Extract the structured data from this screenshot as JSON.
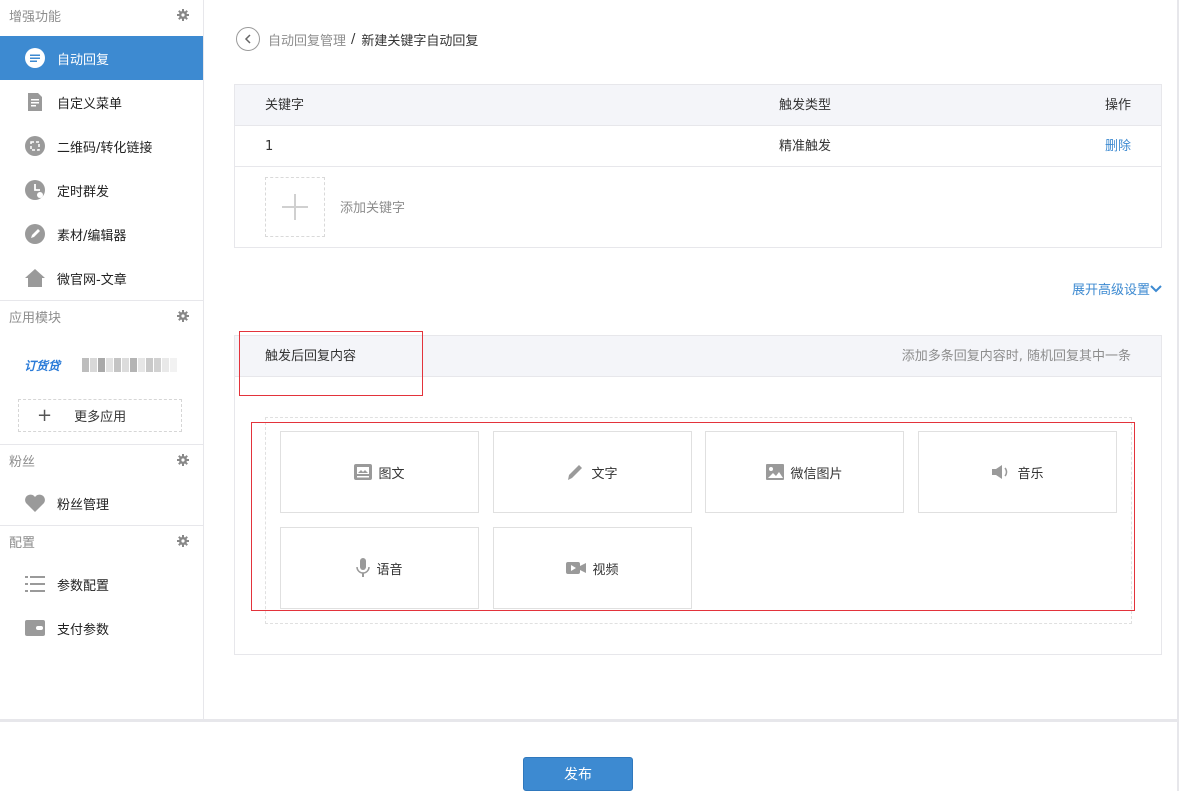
{
  "sidebar": {
    "sections": {
      "enhance": {
        "title": "增强功能"
      },
      "apps": {
        "title": "应用模块"
      },
      "fans": {
        "title": "粉丝"
      },
      "config": {
        "title": "配置"
      }
    },
    "items": {
      "auto_reply": {
        "label": "自动回复",
        "icon": "chat-bubble-icon"
      },
      "custom_menu": {
        "label": "自定义菜单",
        "icon": "document-edit-icon"
      },
      "qrcode": {
        "label": "二维码/转化链接",
        "icon": "qrcode-icon"
      },
      "scheduled": {
        "label": "定时群发",
        "icon": "clock-icon"
      },
      "material": {
        "label": "素材/编辑器",
        "icon": "pencil-icon"
      },
      "microsite": {
        "label": "微官网-文章",
        "icon": "home-icon"
      },
      "fan_manage": {
        "label": "粉丝管理",
        "icon": "heart-icon"
      },
      "params": {
        "label": "参数配置",
        "icon": "list-icon"
      },
      "pay_params": {
        "label": "支付参数",
        "icon": "wallet-icon"
      }
    },
    "app_module": {
      "logo_text": "订货贷"
    },
    "more_apps": {
      "label": "更多应用"
    }
  },
  "breadcrumb": {
    "parent": "自动回复管理",
    "separator": "/",
    "current": "新建关键字自动回复"
  },
  "keyword_table": {
    "headers": {
      "keyword": "关键字",
      "trigger_type": "触发类型",
      "action": "操作"
    },
    "rows": [
      {
        "keyword": "1",
        "trigger_type": "精准触发",
        "action": "删除"
      }
    ],
    "add_label": "添加关键字"
  },
  "advanced": {
    "label": "展开高级设置"
  },
  "reply": {
    "title": "触发后回复内容",
    "hint": "添加多条回复内容时, 随机回复其中一条",
    "types": {
      "news": {
        "label": "图文",
        "icon": "image-text-icon"
      },
      "text": {
        "label": "文字",
        "icon": "pencil-icon"
      },
      "wechat_image": {
        "label": "微信图片",
        "icon": "picture-icon"
      },
      "music": {
        "label": "音乐",
        "icon": "speaker-icon"
      },
      "voice": {
        "label": "语音",
        "icon": "microphone-icon"
      },
      "video": {
        "label": "视频",
        "icon": "video-icon"
      }
    }
  },
  "footer": {
    "publish_label": "发布"
  },
  "colors": {
    "accent": "#3d8ad1",
    "highlight": "#e3333b",
    "icon_gray": "#9a9a9a"
  }
}
